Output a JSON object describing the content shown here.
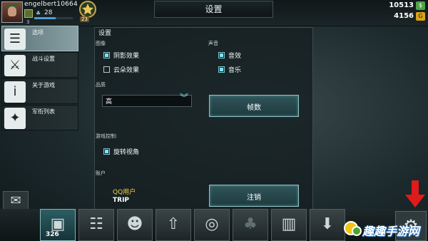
{
  "header": {
    "username": "engelbert10664",
    "level": "28",
    "level_small": "3",
    "xp_progress": 0.55,
    "medal_value": "23",
    "title": "设置",
    "currency_cash": "10513",
    "currency_cash_badge": "$",
    "currency_gold": "4156",
    "currency_gold_badge": "G"
  },
  "sidebar": {
    "items": [
      {
        "label": "选项",
        "icon": "sliders-icon",
        "active": true
      },
      {
        "label": "战斗设置",
        "icon": "crossed-swords-icon",
        "active": false
      },
      {
        "label": "关于游戏",
        "icon": "info-icon",
        "active": false
      },
      {
        "label": "军衔列表",
        "icon": "rank-chevrons-icon",
        "active": false
      }
    ]
  },
  "settings": {
    "title": "设置",
    "graphics": {
      "heading": "图像",
      "shadow_label": "阴影效果",
      "shadow_checked": true,
      "clouds_label": "云朵效果",
      "clouds_checked": false
    },
    "sound": {
      "heading": "声音",
      "sfx_label": "音效",
      "sfx_checked": true,
      "music_label": "音乐",
      "music_checked": true
    },
    "quality": {
      "heading": "品质",
      "selected": "高",
      "fps_button": "帧数"
    },
    "controls": {
      "heading": "游戏控制:",
      "rotate_label": "旋转视角",
      "rotate_checked": true
    },
    "account": {
      "heading": "账户",
      "provider": "QQ用户",
      "name": "TRIP",
      "logout_button": "注销"
    }
  },
  "bottom_bar": {
    "counter": "326",
    "items": [
      {
        "icon": "crate-icon"
      },
      {
        "icon": "checklist-icon"
      },
      {
        "icon": "soldier-icon"
      },
      {
        "icon": "upgrade-arrow-icon"
      },
      {
        "icon": "radar-tank-icon"
      },
      {
        "icon": "team-icon"
      },
      {
        "icon": "buildings-icon"
      },
      {
        "icon": "shop-cart-icon"
      }
    ]
  },
  "watermark_text": "趣趣手游网",
  "colors": {
    "accent": "#7ee3ef",
    "arrow": "#e01b1b",
    "gold": "#f7d348"
  }
}
